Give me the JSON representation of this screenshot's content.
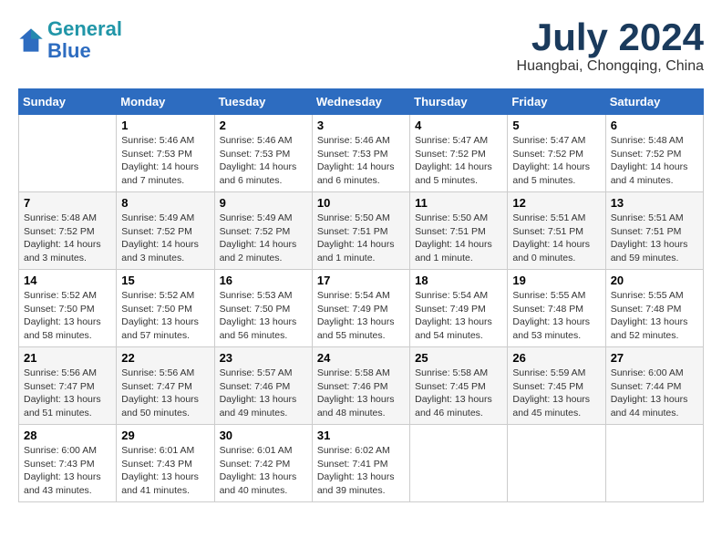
{
  "header": {
    "logo_line1": "General",
    "logo_line2": "Blue",
    "month_year": "July 2024",
    "location": "Huangbai, Chongqing, China"
  },
  "weekdays": [
    "Sunday",
    "Monday",
    "Tuesday",
    "Wednesday",
    "Thursday",
    "Friday",
    "Saturday"
  ],
  "weeks": [
    [
      {
        "day": "",
        "info": ""
      },
      {
        "day": "1",
        "info": "Sunrise: 5:46 AM\nSunset: 7:53 PM\nDaylight: 14 hours\nand 7 minutes."
      },
      {
        "day": "2",
        "info": "Sunrise: 5:46 AM\nSunset: 7:53 PM\nDaylight: 14 hours\nand 6 minutes."
      },
      {
        "day": "3",
        "info": "Sunrise: 5:46 AM\nSunset: 7:53 PM\nDaylight: 14 hours\nand 6 minutes."
      },
      {
        "day": "4",
        "info": "Sunrise: 5:47 AM\nSunset: 7:52 PM\nDaylight: 14 hours\nand 5 minutes."
      },
      {
        "day": "5",
        "info": "Sunrise: 5:47 AM\nSunset: 7:52 PM\nDaylight: 14 hours\nand 5 minutes."
      },
      {
        "day": "6",
        "info": "Sunrise: 5:48 AM\nSunset: 7:52 PM\nDaylight: 14 hours\nand 4 minutes."
      }
    ],
    [
      {
        "day": "7",
        "info": "Sunrise: 5:48 AM\nSunset: 7:52 PM\nDaylight: 14 hours\nand 3 minutes."
      },
      {
        "day": "8",
        "info": "Sunrise: 5:49 AM\nSunset: 7:52 PM\nDaylight: 14 hours\nand 3 minutes."
      },
      {
        "day": "9",
        "info": "Sunrise: 5:49 AM\nSunset: 7:52 PM\nDaylight: 14 hours\nand 2 minutes."
      },
      {
        "day": "10",
        "info": "Sunrise: 5:50 AM\nSunset: 7:51 PM\nDaylight: 14 hours\nand 1 minute."
      },
      {
        "day": "11",
        "info": "Sunrise: 5:50 AM\nSunset: 7:51 PM\nDaylight: 14 hours\nand 1 minute."
      },
      {
        "day": "12",
        "info": "Sunrise: 5:51 AM\nSunset: 7:51 PM\nDaylight: 14 hours\nand 0 minutes."
      },
      {
        "day": "13",
        "info": "Sunrise: 5:51 AM\nSunset: 7:51 PM\nDaylight: 13 hours\nand 59 minutes."
      }
    ],
    [
      {
        "day": "14",
        "info": "Sunrise: 5:52 AM\nSunset: 7:50 PM\nDaylight: 13 hours\nand 58 minutes."
      },
      {
        "day": "15",
        "info": "Sunrise: 5:52 AM\nSunset: 7:50 PM\nDaylight: 13 hours\nand 57 minutes."
      },
      {
        "day": "16",
        "info": "Sunrise: 5:53 AM\nSunset: 7:50 PM\nDaylight: 13 hours\nand 56 minutes."
      },
      {
        "day": "17",
        "info": "Sunrise: 5:54 AM\nSunset: 7:49 PM\nDaylight: 13 hours\nand 55 minutes."
      },
      {
        "day": "18",
        "info": "Sunrise: 5:54 AM\nSunset: 7:49 PM\nDaylight: 13 hours\nand 54 minutes."
      },
      {
        "day": "19",
        "info": "Sunrise: 5:55 AM\nSunset: 7:48 PM\nDaylight: 13 hours\nand 53 minutes."
      },
      {
        "day": "20",
        "info": "Sunrise: 5:55 AM\nSunset: 7:48 PM\nDaylight: 13 hours\nand 52 minutes."
      }
    ],
    [
      {
        "day": "21",
        "info": "Sunrise: 5:56 AM\nSunset: 7:47 PM\nDaylight: 13 hours\nand 51 minutes."
      },
      {
        "day": "22",
        "info": "Sunrise: 5:56 AM\nSunset: 7:47 PM\nDaylight: 13 hours\nand 50 minutes."
      },
      {
        "day": "23",
        "info": "Sunrise: 5:57 AM\nSunset: 7:46 PM\nDaylight: 13 hours\nand 49 minutes."
      },
      {
        "day": "24",
        "info": "Sunrise: 5:58 AM\nSunset: 7:46 PM\nDaylight: 13 hours\nand 48 minutes."
      },
      {
        "day": "25",
        "info": "Sunrise: 5:58 AM\nSunset: 7:45 PM\nDaylight: 13 hours\nand 46 minutes."
      },
      {
        "day": "26",
        "info": "Sunrise: 5:59 AM\nSunset: 7:45 PM\nDaylight: 13 hours\nand 45 minutes."
      },
      {
        "day": "27",
        "info": "Sunrise: 6:00 AM\nSunset: 7:44 PM\nDaylight: 13 hours\nand 44 minutes."
      }
    ],
    [
      {
        "day": "28",
        "info": "Sunrise: 6:00 AM\nSunset: 7:43 PM\nDaylight: 13 hours\nand 43 minutes."
      },
      {
        "day": "29",
        "info": "Sunrise: 6:01 AM\nSunset: 7:43 PM\nDaylight: 13 hours\nand 41 minutes."
      },
      {
        "day": "30",
        "info": "Sunrise: 6:01 AM\nSunset: 7:42 PM\nDaylight: 13 hours\nand 40 minutes."
      },
      {
        "day": "31",
        "info": "Sunrise: 6:02 AM\nSunset: 7:41 PM\nDaylight: 13 hours\nand 39 minutes."
      },
      {
        "day": "",
        "info": ""
      },
      {
        "day": "",
        "info": ""
      },
      {
        "day": "",
        "info": ""
      }
    ]
  ]
}
